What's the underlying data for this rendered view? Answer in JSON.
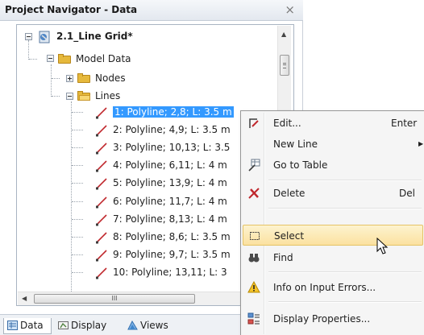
{
  "window": {
    "title": "Project Navigator - Data",
    "close_glyph": "×"
  },
  "tree": {
    "project": "2.1_Line Grid*",
    "model_data": "Model Data",
    "nodes": "Nodes",
    "lines": "Lines",
    "line_items": [
      "1: Polyline; 2,8; L: 3.5 m",
      "2: Polyline; 4,9; L: 3.5 m",
      "3: Polyline; 10,13; L: 3.5",
      "4: Polyline; 6,11; L: 4 m",
      "5: Polyline; 13,9; L: 4 m",
      "6: Polyline; 11,7; L: 4 m",
      "7: Polyline; 8,13; L: 4 m",
      "8: Polyline; 8,6; L: 3.5 m",
      "9: Polyline; 9,7; L: 3.5 m",
      "10: Polyline; 13,11; L: 3"
    ],
    "selected_index": 0
  },
  "scrollbar_h": {
    "grip": "III"
  },
  "bottom_tabs": [
    {
      "label": "Data",
      "icon": "data-icon",
      "active": true
    },
    {
      "label": "Display",
      "icon": "display-icon",
      "active": false
    },
    {
      "label": "Views",
      "icon": "views-icon",
      "active": false
    }
  ],
  "context_menu": {
    "items": [
      {
        "label": "Edit...",
        "shortcut": "Enter",
        "icon": "edit-icon"
      },
      {
        "label": "New Line",
        "shortcut": "",
        "icon": ""
      },
      {
        "label": "Go to Table",
        "shortcut": "",
        "icon": "table-icon"
      },
      {
        "label": "Delete",
        "shortcut": "Del",
        "icon": "delete-icon"
      },
      {
        "label": "Select",
        "shortcut": "",
        "icon": "select-icon",
        "highlighted": true
      },
      {
        "label": "Find",
        "shortcut": "",
        "icon": "binoculars-icon"
      },
      {
        "label": "Info on Input Errors...",
        "shortcut": "",
        "icon": "warning-icon"
      },
      {
        "label": "Display Properties...",
        "shortcut": "",
        "icon": "display-properties-icon"
      }
    ]
  },
  "colors": {
    "selection": "#3399ff",
    "menu_highlight": "#fbe1a0",
    "folder": "#e6b93c",
    "line_icon": "#c0282d"
  }
}
